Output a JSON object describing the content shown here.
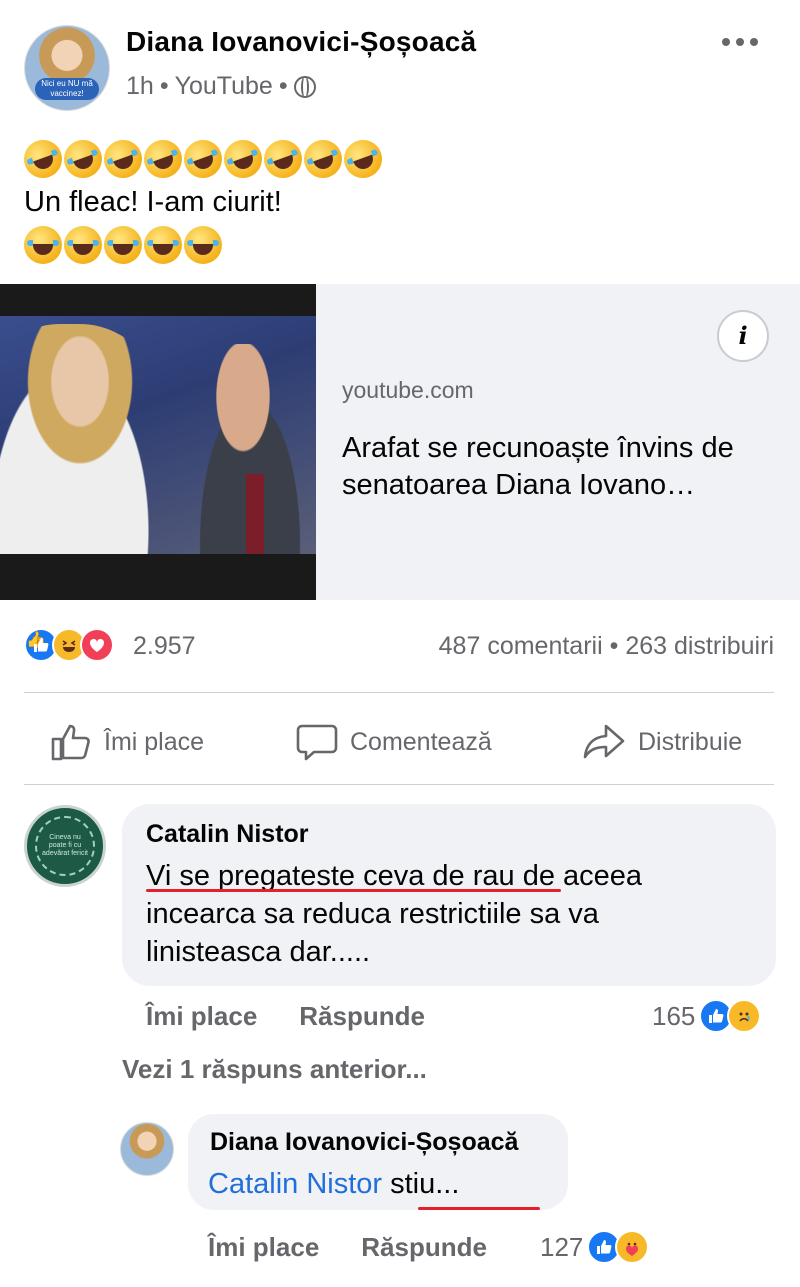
{
  "post": {
    "author": "Diana Iovanovici-Șoșoacă",
    "time": "1h",
    "source": "YouTube",
    "separator": "•",
    "avatar_caption": "Nici eu NU mă vaccinez!",
    "text": "Un fleac! I-am ciurit!",
    "emoji_row_1_count": 9,
    "emoji_row_2_count": 5
  },
  "link_preview": {
    "domain": "youtube.com",
    "title": "Arafat se recunoaște învins de senatoarea Diana Iovano…",
    "info_icon": "i"
  },
  "stats": {
    "reactions": [
      "like-icon",
      "haha-icon",
      "love-icon"
    ],
    "reaction_count": "2.957",
    "comments": "487 comentarii",
    "shares": "263 distribuiri"
  },
  "actions": {
    "like": "Îmi place",
    "comment": "Comentează",
    "share": "Distribuie"
  },
  "comments": [
    {
      "author": "Catalin Nistor",
      "avatar_caption": "Cineva nu poate fi cu adevărat fericit",
      "text_underlined": "Vi se pregateste ceva de rau",
      "text_rest": " de aceea",
      "text_line2": "incearca sa reduca restrictiile sa va",
      "text_line3": "linisteasca dar.....",
      "like_label": "Îmi place",
      "reply_label": "Răspunde",
      "reaction_count": "165"
    }
  ],
  "view_previous": "Vezi 1 răspuns anterior...",
  "reply": {
    "author": "Diana Iovanovici-Șoșoacă",
    "mention": "Catalin Nistor",
    "text": "stiu...",
    "like_label": "Îmi place",
    "reply_label": "Răspunde",
    "reaction_count": "127"
  },
  "colors": {
    "accent": "#1877f2",
    "mention": "#216fdb",
    "underline": "#e4212b",
    "secondary_text": "#65676b",
    "bubble": "#f0f2f5"
  }
}
